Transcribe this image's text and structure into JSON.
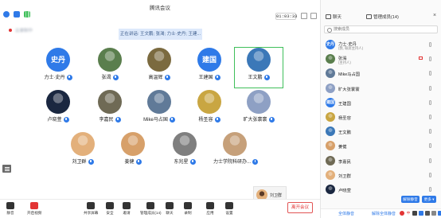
{
  "app": {
    "title": "腾讯会议",
    "timer": "01:03:33"
  },
  "status": {
    "recording_text": "云录制中"
  },
  "speaking": {
    "text": "正在讲话: 王文鹏; 张渴; 力士·史丹; 王建..."
  },
  "participants": [
    {
      "name": "力士·史丹",
      "avatar_text": "史丹",
      "avatar_color": "#2f7ae8"
    },
    {
      "name": "张渴",
      "avatar_text": "",
      "avatar_color": "#5a7e4d"
    },
    {
      "name": "高温辉",
      "avatar_text": "",
      "avatar_color": "#7b6a3f"
    },
    {
      "name": "王建国",
      "avatar_text": "建国",
      "avatar_color": "#2f7ae8"
    },
    {
      "name": "王文鹏",
      "avatar_text": "",
      "avatar_color": "#3b78b8"
    },
    {
      "name": "卢晓萱",
      "avatar_text": "",
      "avatar_color": "#1a2740"
    },
    {
      "name": "李嘉民",
      "avatar_text": "",
      "avatar_color": "#6f6a55"
    },
    {
      "name": "Mike马占国",
      "avatar_text": "",
      "avatar_color": "#607a98"
    },
    {
      "name": "杨圣容",
      "avatar_text": "",
      "avatar_color": "#c9a642"
    },
    {
      "name": "旷大张寰寰",
      "avatar_text": "",
      "avatar_color": "#8ea0c4"
    },
    {
      "name": "刘卫群",
      "avatar_text": "",
      "avatar_color": "#e3b07b"
    },
    {
      "name": "姜健",
      "avatar_text": "",
      "avatar_color": "#d7a06a"
    },
    {
      "name": "东兆星",
      "avatar_text": "",
      "avatar_color": "#7f7f7f"
    },
    {
      "name": "力士学院科研办...",
      "avatar_text": "",
      "avatar_color": "#c6a07a"
    }
  ],
  "camera_user": {
    "name": "刘卫群",
    "avatar_color": "#e3b07b"
  },
  "toolbar": {
    "items": [
      {
        "label": "静音",
        "icon": "mic-icon",
        "color": "#333333"
      },
      {
        "label": "开启视频",
        "icon": "camera-off-icon",
        "color": "#e23434"
      },
      {
        "label": "共享屏幕",
        "icon": "share-screen-icon",
        "color": "#333333"
      },
      {
        "label": "安全",
        "icon": "shield-icon",
        "color": "#333333"
      },
      {
        "label": "邀请",
        "icon": "invite-icon",
        "color": "#333333"
      },
      {
        "label": "管理成员(14)",
        "icon": "members-icon",
        "color": "#333333"
      },
      {
        "label": "聊天",
        "icon": "chat-icon",
        "color": "#333333"
      },
      {
        "label": "录制",
        "icon": "record-icon",
        "color": "#333333"
      },
      {
        "label": "应用",
        "icon": "apps-icon",
        "color": "#333333"
      },
      {
        "label": "设置",
        "icon": "settings-icon",
        "color": "#333333"
      }
    ],
    "leave": "离开会议"
  },
  "panel": {
    "tab_chat": "聊天",
    "tab_members": "管理成员(14)",
    "search_placeholder": "搜索成员",
    "members": [
      {
        "name": "力士·史丹",
        "sub": "(我, 联席主持人)",
        "avatar_text": "史丹",
        "avatar_color": "#2f7ae8",
        "cam_off": false
      },
      {
        "name": "张渴",
        "sub": "(主持人)",
        "avatar_text": "",
        "avatar_color": "#5a7e4d",
        "cam_off": true
      },
      {
        "name": "Mike马占国",
        "sub": "",
        "avatar_text": "",
        "avatar_color": "#607a98",
        "cam_off": false
      },
      {
        "name": "旷大张寰寰",
        "sub": "",
        "avatar_text": "",
        "avatar_color": "#8ea0c4",
        "cam_off": false
      },
      {
        "name": "王建国",
        "sub": "",
        "avatar_text": "建国",
        "avatar_color": "#2f7ae8",
        "cam_off": false
      },
      {
        "name": "杨圣容",
        "sub": "",
        "avatar_text": "",
        "avatar_color": "#c9a642",
        "cam_off": false
      },
      {
        "name": "王文鹏",
        "sub": "",
        "avatar_text": "",
        "avatar_color": "#3b78b8",
        "cam_off": false
      },
      {
        "name": "姜健",
        "sub": "",
        "avatar_text": "",
        "avatar_color": "#d7a06a",
        "cam_off": false
      },
      {
        "name": "李嘉民",
        "sub": "",
        "avatar_text": "",
        "avatar_color": "#6f6a55",
        "cam_off": false
      },
      {
        "name": "刘卫群",
        "sub": "",
        "avatar_text": "",
        "avatar_color": "#e3b07b",
        "cam_off": false
      },
      {
        "name": "卢晓萱",
        "sub": "",
        "avatar_text": "",
        "avatar_color": "#1a2740",
        "cam_off": false
      }
    ],
    "unmute_btn": "解除静音",
    "more_btn": "更多 ▾",
    "mute_all": "全体静音",
    "unmute_all": "解除全体静音",
    "ime_cn": "中"
  },
  "colors": {
    "accent": "#2f7ae8",
    "danger": "#e23434",
    "active_border": "#3fbf5a"
  }
}
